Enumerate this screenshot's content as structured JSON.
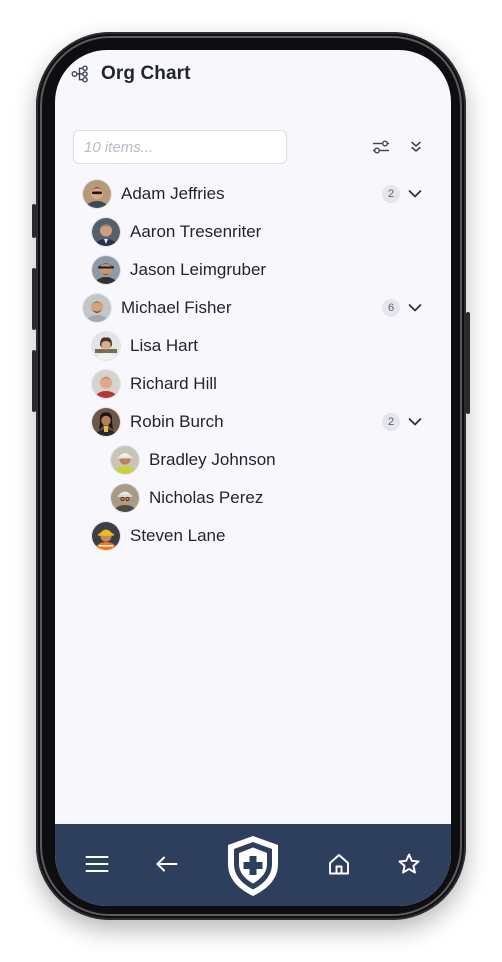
{
  "app": {
    "title": "Org Chart",
    "title_icon": "org-chart-icon"
  },
  "toolbar": {
    "search_placeholder": "10 items...",
    "search_value": "",
    "filter_icon": "sliders-icon",
    "collapse_icon": "double-chevron-down-icon"
  },
  "tree": {
    "items": [
      {
        "name": "Adam Jeffries",
        "level": 0,
        "count": "2",
        "expanded": true
      },
      {
        "name": "Aaron Tresenriter",
        "level": 1
      },
      {
        "name": "Jason Leimgruber",
        "level": 1
      },
      {
        "name": "Michael Fisher",
        "level": 0,
        "count": "6",
        "expanded": true
      },
      {
        "name": "Lisa Hart",
        "level": 1
      },
      {
        "name": "Richard Hill",
        "level": 1
      },
      {
        "name": "Robin Burch",
        "level": 1,
        "count": "2",
        "expanded": true
      },
      {
        "name": "Bradley Johnson",
        "level": 2
      },
      {
        "name": "Nicholas Perez",
        "level": 2
      },
      {
        "name": "Steven Lane",
        "level": 1
      }
    ]
  },
  "bottom_nav": {
    "items": [
      "menu-icon",
      "arrow-left-icon",
      "shield-logo-icon",
      "home-icon",
      "star-icon"
    ]
  },
  "colors": {
    "nav_background": "#2e3e5d",
    "screen_background": "#f8f7fc",
    "badge_background": "#e4e6ec"
  }
}
